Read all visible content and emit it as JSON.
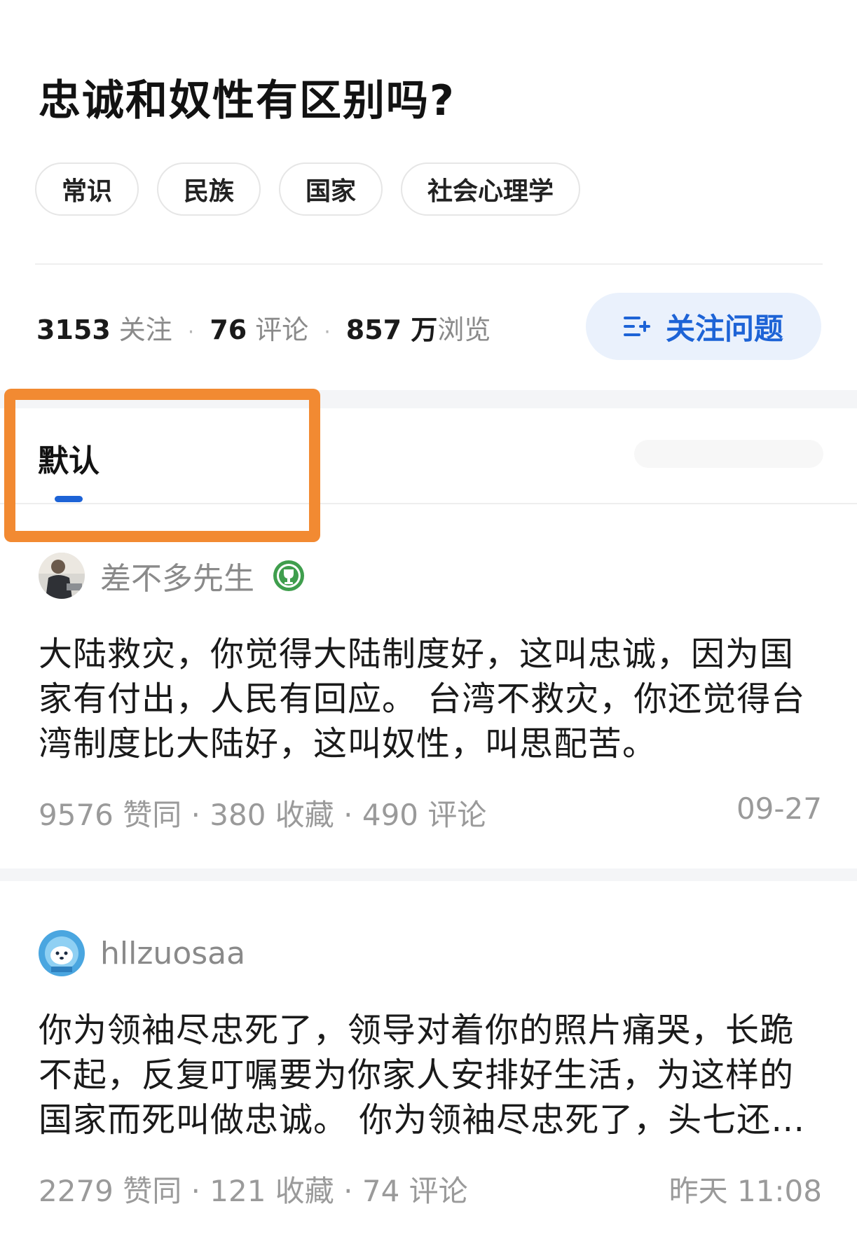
{
  "question": {
    "title": "忠诚和奴性有区别吗?",
    "tags": [
      "常识",
      "民族",
      "国家",
      "社会心理学"
    ]
  },
  "stats": {
    "followers": "3153",
    "followers_label": "关注",
    "comments": "76",
    "comments_label": "评论",
    "views": "857 万",
    "views_label": "浏览",
    "separator": "·"
  },
  "follow_button": {
    "label": "关注问题",
    "icon": "follow-question-icon",
    "color": "#1d63d6"
  },
  "sort": {
    "active_tab": "默认",
    "highlight_color": "#f28a32"
  },
  "answers": [
    {
      "author": "差不多先生",
      "badge": "trophy-badge-icon",
      "body": "大陆救灾，你觉得大陆制度好，这叫忠诚，因为国家有付出，人民有回应。 台湾不救灾，你还觉得台湾制度比大陆好，这叫奴性，叫思配苦。",
      "meta": "9576 赞同 · 380 收藏 · 490 评论",
      "date": "09-27"
    },
    {
      "author": "hllzuosaa",
      "body": "你为领袖尽忠死了，领导对着你的照片痛哭，长跪不起，反复叮嘱要为你家人安排好生活，为这样的国家而死叫做忠诚。 你为领袖尽忠死了，头七还…",
      "meta": "2279 赞同 · 121 收藏 · 74 评论",
      "date": "昨天 11:08"
    }
  ]
}
